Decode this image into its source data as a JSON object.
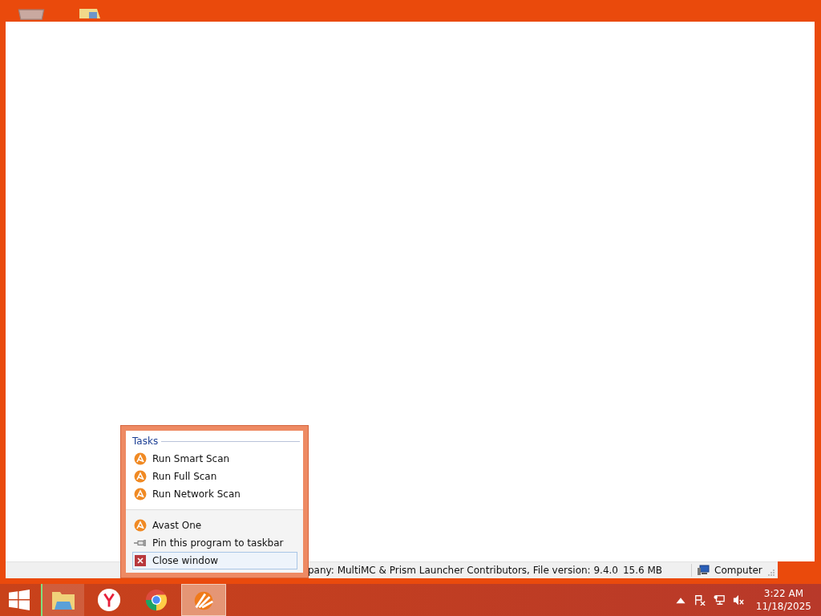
{
  "desktop": {
    "icons": [
      {
        "kind": "bin"
      },
      {
        "kind": "folder"
      }
    ]
  },
  "status_bar": {
    "details": "pany: MultiMC & Prism Launcher Contributors, File version: 9.4.0",
    "size": "15.6 MB",
    "location": "Computer"
  },
  "jump_list": {
    "header": "Tasks",
    "tasks": [
      {
        "label": "Run Smart Scan",
        "selected": false
      },
      {
        "label": "Run Full Scan",
        "selected": false
      },
      {
        "label": "Run Network Scan",
        "selected": false
      }
    ],
    "items": [
      {
        "kind": "app",
        "label": "Avast One",
        "selected": false
      },
      {
        "kind": "pin",
        "label": "Pin this program to taskbar",
        "selected": false
      },
      {
        "kind": "close",
        "label": "Close window",
        "selected": true
      }
    ]
  },
  "taskbar": {
    "apps": [
      {
        "kind": "explorer",
        "selected": false
      },
      {
        "kind": "yandex",
        "selected": false
      },
      {
        "kind": "chrome",
        "selected": false
      },
      {
        "kind": "avast",
        "selected": true
      }
    ],
    "clock": {
      "time": "3:22 AM",
      "date": "11/18/2025"
    }
  }
}
